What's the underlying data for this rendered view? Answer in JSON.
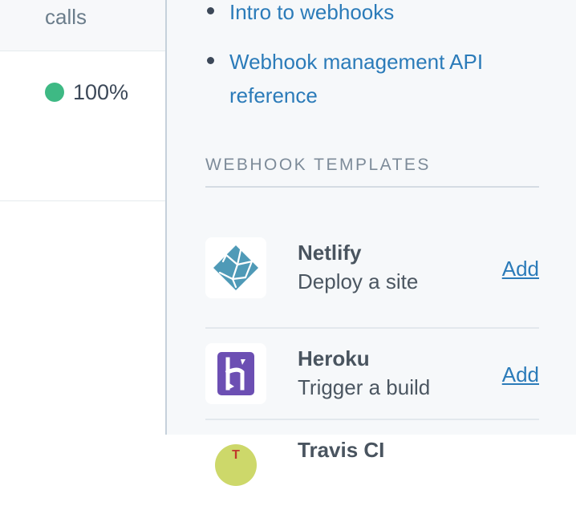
{
  "table": {
    "column_header": "calls",
    "rows": [
      {
        "status_color": "#3eb984",
        "success_rate": "100%"
      }
    ]
  },
  "sidebar": {
    "links": [
      {
        "label": "Intro to webhooks"
      },
      {
        "label": "Webhook management API reference"
      }
    ],
    "section_title": "WEBHOOK TEMPLATES",
    "templates": [
      {
        "name": "Netlify",
        "description": "Deploy a site",
        "action": "Add",
        "icon": "netlify-icon"
      },
      {
        "name": "Heroku",
        "description": "Trigger a build",
        "action": "Add",
        "icon": "heroku-icon"
      },
      {
        "name": "Travis CI",
        "description": "",
        "action": "",
        "icon": "travis-ci-icon"
      }
    ]
  },
  "colors": {
    "link": "#2b7bb9",
    "success": "#3eb984",
    "heroku": "#6c4fb3",
    "netlify": "#4f9ab7"
  }
}
